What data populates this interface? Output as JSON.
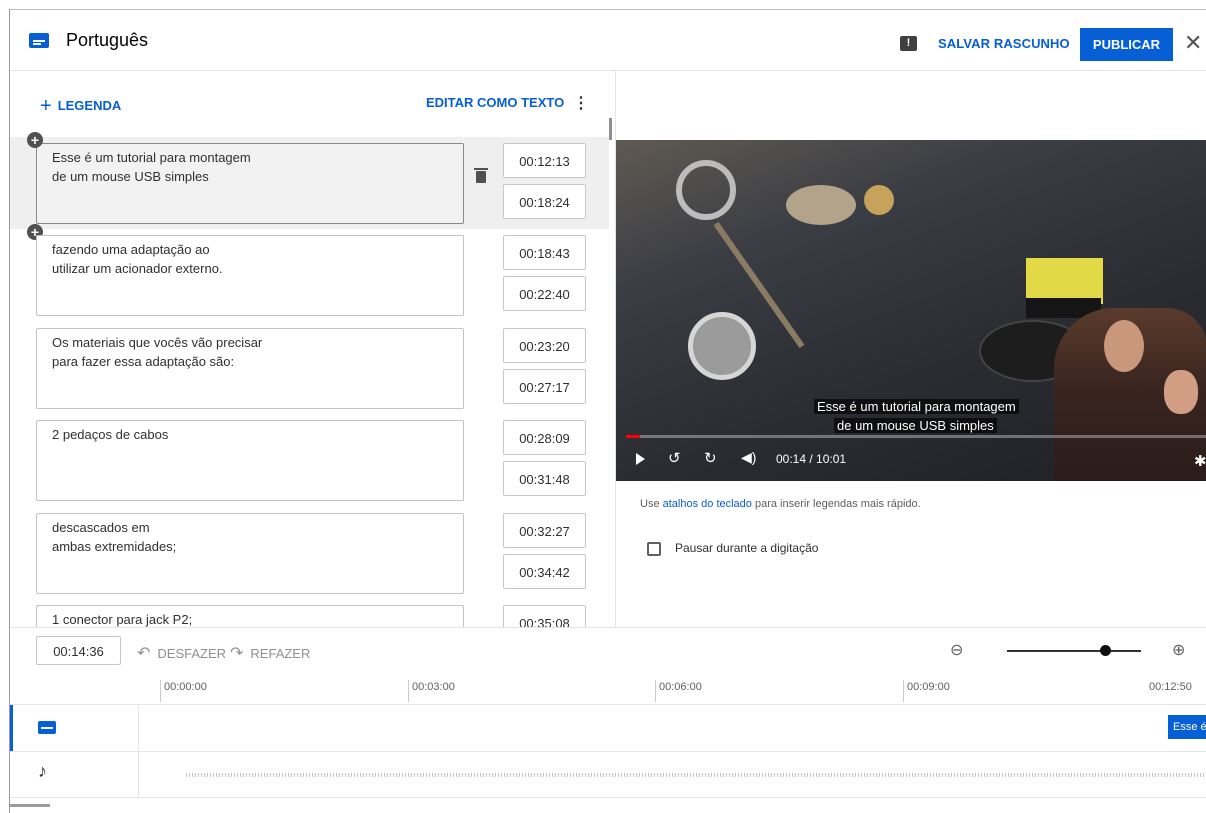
{
  "header": {
    "title": "Português",
    "save_draft": "SALVAR RASCUNHO",
    "publish": "PUBLICAR",
    "close": "✕"
  },
  "editor": {
    "add_caption": "LEGENDA",
    "edit_as_text": "EDITAR COMO TEXTO",
    "more": "⋮"
  },
  "cues": [
    {
      "text": "Esse é um tutorial para montagem\nde um mouse USB simples",
      "start": "00:12:13",
      "end": "00:18:24"
    },
    {
      "text": "fazendo uma adaptação ao\nutilizar um acionador externo.",
      "start": "00:18:43",
      "end": "00:22:40"
    },
    {
      "text": "Os materiais que vocês vão precisar\npara fazer essa adaptação são:",
      "start": "00:23:20",
      "end": "00:27:17"
    },
    {
      "text": "2 pedaços de cabos",
      "start": "00:28:09",
      "end": "00:31:48"
    },
    {
      "text": "descascados em\nambas extremidades;",
      "start": "00:32:27",
      "end": "00:34:42"
    },
    {
      "text": "1 conector para jack P2;",
      "start": "00:35:08",
      "end": ""
    }
  ],
  "video": {
    "subtitle_line1": "Esse é um tutorial para montagem",
    "subtitle_line2": "de um mouse USB simples",
    "time_readout": "00:14 / 10:01",
    "progress_fraction": 0.023
  },
  "hint": {
    "prefix": "Use ",
    "link": "atalhos do teclado",
    "suffix": " para inserir legendas mais rápido."
  },
  "pause_label": "Pausar durante a digitação",
  "toolbar": {
    "current_time": "00:14:36",
    "undo": "DESFAZER",
    "redo": "REFAZER"
  },
  "ruler": [
    "00:00:00",
    "00:03:00",
    "00:06:00",
    "00:09:00",
    "00:12:50"
  ],
  "timeline": {
    "caption_chip": "Esse é"
  },
  "colors": {
    "accent": "#065fd4"
  }
}
